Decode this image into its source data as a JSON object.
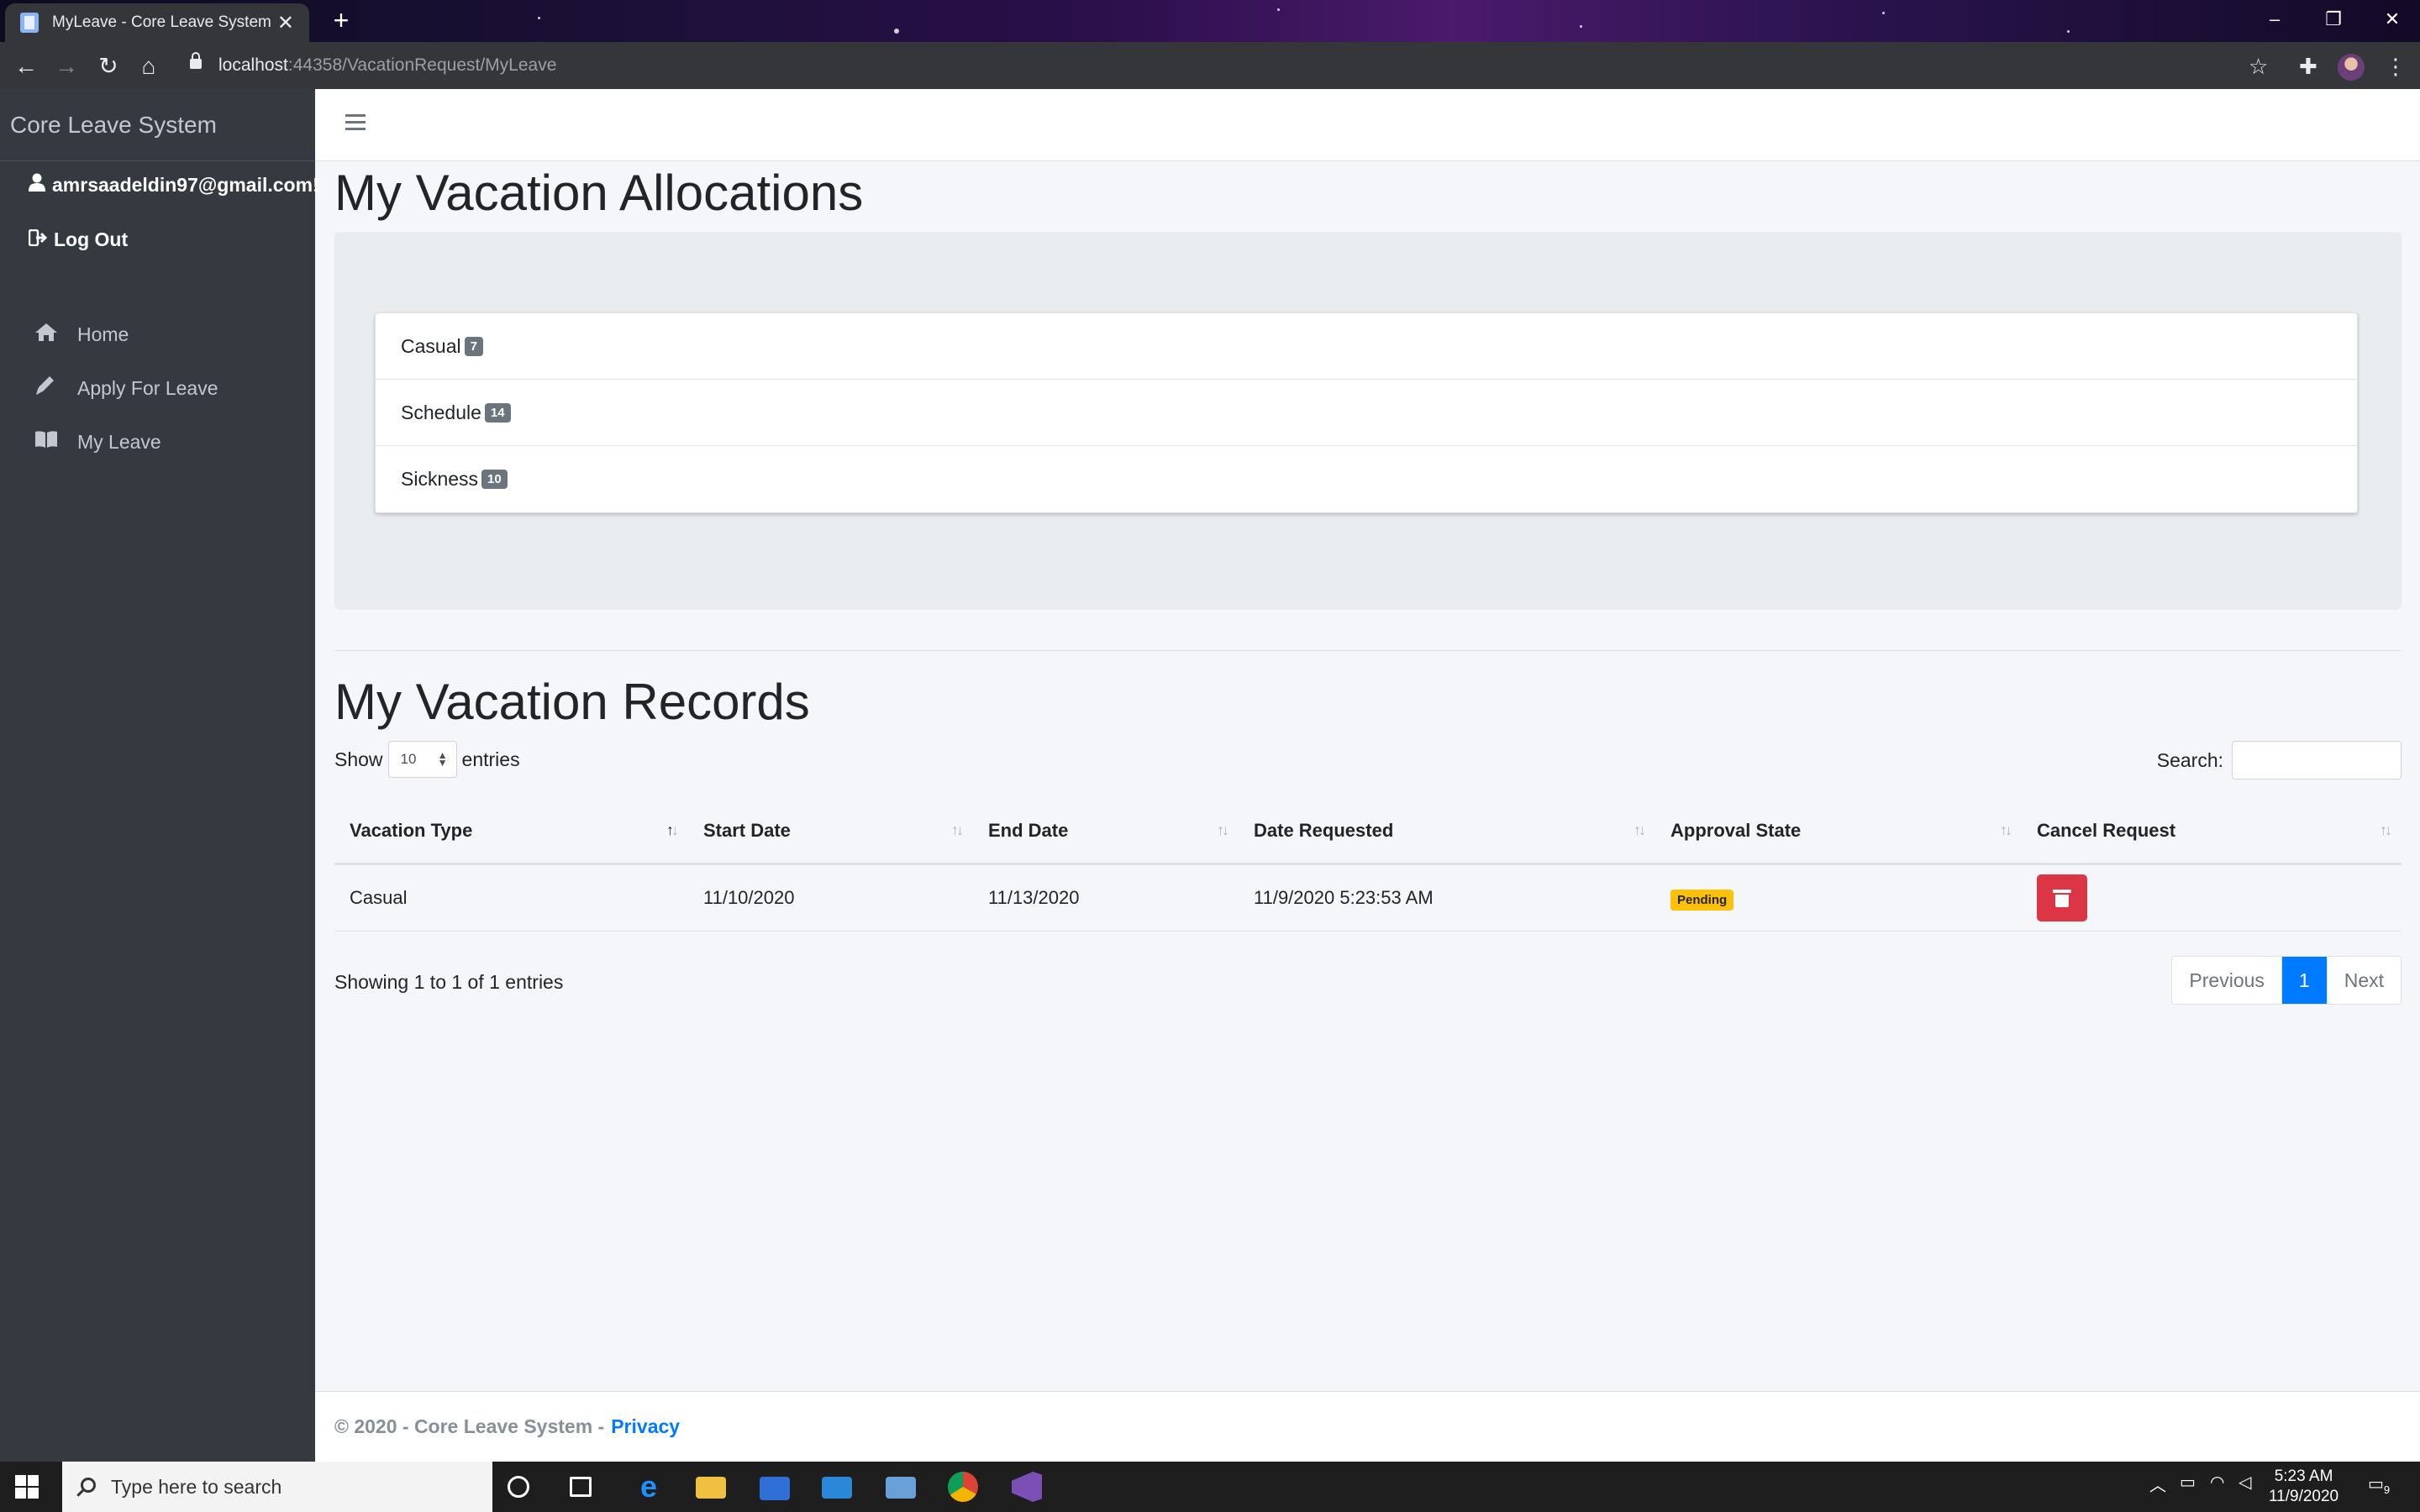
{
  "browser": {
    "tab_title": "MyLeave - Core Leave System",
    "url_host": "localhost",
    "url_rest": ":44358/VacationRequest/MyLeave"
  },
  "sidebar": {
    "brand": "Core Leave System",
    "user_email": "amrsaadeldin97@gmail.com!",
    "logout": "Log Out",
    "nav": [
      {
        "label": "Home",
        "icon": "home-icon"
      },
      {
        "label": "Apply For Leave",
        "icon": "pencil-icon"
      },
      {
        "label": "My Leave",
        "icon": "book-icon"
      }
    ]
  },
  "allocations": {
    "title": "My Vacation Allocations",
    "items": [
      {
        "name": "Casual",
        "count": "7"
      },
      {
        "name": "Schedule",
        "count": "14"
      },
      {
        "name": "Sickness",
        "count": "10"
      }
    ]
  },
  "records": {
    "title": "My Vacation Records",
    "show_label": "Show",
    "entries_label": "entries",
    "page_length": "10",
    "search_label": "Search:",
    "search_value": "",
    "columns": [
      "Vacation Type",
      "Start Date",
      "End Date",
      "Date Requested",
      "Approval State",
      "Cancel Request"
    ],
    "rows": [
      {
        "type": "Casual",
        "start": "11/10/2020",
        "end": "11/13/2020",
        "requested": "11/9/2020 5:23:53 AM",
        "state": "Pending"
      }
    ],
    "info": "Showing 1 to 1 of 1 entries",
    "pager": {
      "previous": "Previous",
      "current": "1",
      "next": "Next"
    }
  },
  "footer": {
    "text": "© 2020 - Core Leave System -",
    "privacy": "Privacy"
  },
  "taskbar": {
    "search_placeholder": "Type here to search",
    "time": "5:23 AM",
    "date": "11/9/2020",
    "notifications": "9"
  },
  "colors": {
    "sidebar_bg": "#343a40",
    "primary": "#007bff",
    "danger": "#dc3545",
    "warning": "#ffc107",
    "badge": "#6c757d"
  }
}
